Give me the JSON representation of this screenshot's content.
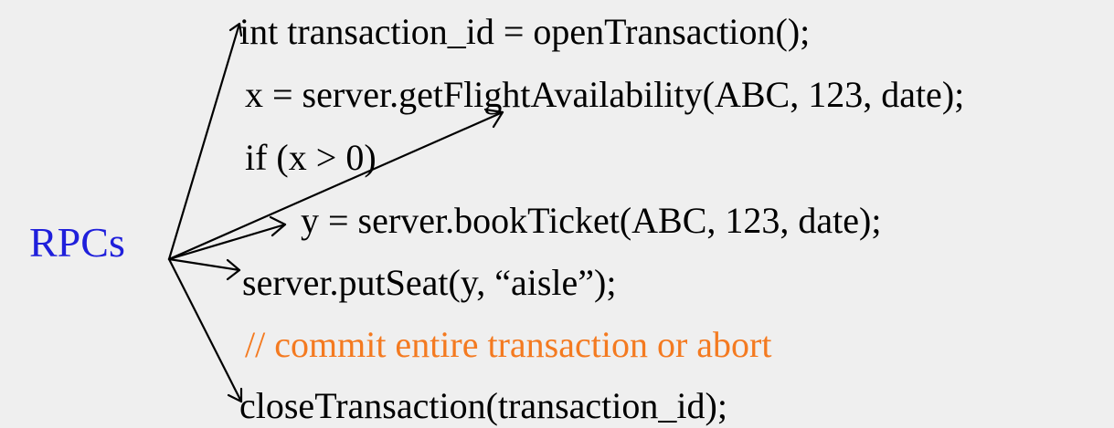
{
  "label": {
    "text": "RPCs",
    "color": "#1f1fdb"
  },
  "code_lines": [
    {
      "text": "int transaction_id = openTransaction();",
      "color": "#000000"
    },
    {
      "text": "x = server.getFlightAvailability(ABC, 123, date);",
      "color": "#000000"
    },
    {
      "text": "if (x > 0)",
      "color": "#000000"
    },
    {
      "text": "y = server.bookTicket(ABC, 123, date);",
      "color": "#000000"
    },
    {
      "text": "server.putSeat(y, “aisle”);",
      "color": "#000000"
    },
    {
      "text": "// commit entire transaction or abort",
      "color": "#f47a20"
    },
    {
      "text": "closeTransaction(transaction_id);",
      "color": "#000000"
    }
  ],
  "arrow_color": "#000000"
}
